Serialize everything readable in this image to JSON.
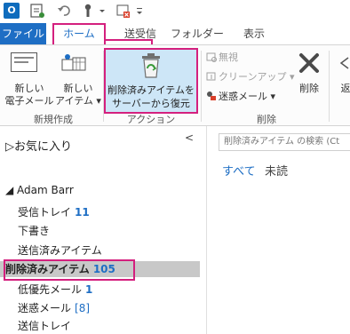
{
  "qat": {
    "app_icon_text": "O"
  },
  "tabs": {
    "file": "ファイル",
    "home": "ホーム",
    "send_receive": "送受信",
    "folder": "フォルダー",
    "view": "表示"
  },
  "ribbon": {
    "new_group": {
      "new_email_l1": "新しい",
      "new_email_l2": "電子メール",
      "new_items_l1": "新しい",
      "new_items_l2": "アイテム ▾",
      "label": "新規作成"
    },
    "actions_group": {
      "restore_l1": "削除済みアイテムを",
      "restore_l2": "サーバーから復元",
      "label": "アクション"
    },
    "delete_group": {
      "ignore": "無視",
      "cleanup": "クリーンアップ ▾",
      "junk": "迷惑メール ▾",
      "delete": "削除",
      "label": "削除",
      "reply_partial": "返"
    }
  },
  "pane": {
    "collapse_glyph": "<",
    "favorites": "▷お気に入り",
    "account": "◢ Adam Barr",
    "folders": [
      {
        "name": "受信トレイ",
        "count": "11"
      },
      {
        "name": "下書き",
        "count": ""
      },
      {
        "name": "送信済みアイテム",
        "count": ""
      },
      {
        "name": "削除済みアイテム",
        "count": "105"
      },
      {
        "name": "低優先メール",
        "count": "1"
      },
      {
        "name": "迷惑メール",
        "count": "[8]"
      },
      {
        "name": "送信トレイ",
        "count": ""
      }
    ]
  },
  "list": {
    "search_placeholder": "削除済みアイテム の検索 (Ct",
    "filter_all": "すべて",
    "filter_unread": "未読"
  },
  "colors": {
    "accent": "#1e6ec4",
    "highlight": "#d4207e",
    "selected_bg": "#c8c8c8",
    "restore_bg": "#cde6f7"
  }
}
